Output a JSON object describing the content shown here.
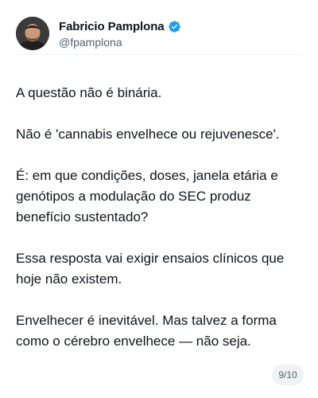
{
  "author": {
    "name": "Fabricio Pamplona",
    "handle": "@fpamplona",
    "avatar_icon": "profile-photo",
    "verified_icon": "verified-badge-icon",
    "verified_color": "#1d9bf0"
  },
  "post": {
    "paragraphs": [
      "A questão não é binária.",
      "Não é 'cannabis envelhece ou rejuvenesce'.",
      "É: em que condições, doses, janela etária e genótipos a modulação do SEC produz benefício sustentado?",
      "Essa resposta vai exigir ensaios clínicos que hoje não existem.",
      "Envelhecer é inevitável. Mas talvez a forma como o cérebro envelhece — não seja."
    ]
  },
  "pagination": {
    "label": "9/10"
  }
}
